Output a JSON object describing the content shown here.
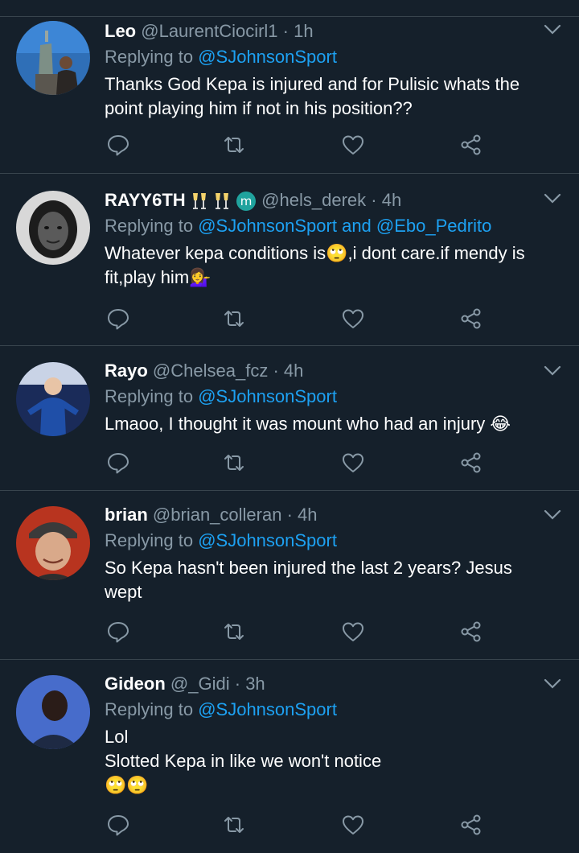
{
  "tweets": [
    {
      "name": "Leo",
      "handle": "@LaurentCiocirl1",
      "dot": "·",
      "time": "1h",
      "replying_prefix": "Replying to",
      "replying_to": "@SJohnsonSport",
      "text_lines": [
        "Thanks God Kepa is injured and for Pulisic whats the",
        "point playing him if not in his position??"
      ],
      "avatar_icon": "statue-of-liberty-photo"
    },
    {
      "name": "RAYY6TH",
      "name_emojis": [
        "champagne-emoji",
        "champagne-emoji",
        "scorpio-emoji"
      ],
      "handle": "@hels_derek",
      "dot": "·",
      "time": "4h",
      "replying_prefix": "Replying to",
      "replying_to": "@SJohnsonSport and @Ebo_Pedrito",
      "text_lines": [
        "Whatever kepa conditions is🙄,i dont care.if mendy is",
        "fit,play him💁‍♀️"
      ],
      "avatar_icon": "woman-bw-photo"
    },
    {
      "name": "Rayo",
      "handle": "@Chelsea_fcz",
      "dot": "·",
      "time": "4h",
      "replying_prefix": "Replying to",
      "replying_to": "@SJohnsonSport",
      "text_lines": [
        "Lmaoo, I thought it was mount who had an injury 😂"
      ],
      "avatar_icon": "chelsea-player-photo"
    },
    {
      "name": "brian",
      "handle": "@brian_colleran",
      "dot": "·",
      "time": "4h",
      "replying_prefix": "Replying to",
      "replying_to": "@SJohnsonSport",
      "text_lines": [
        "So Kepa hasn't been injured the last 2 years? Jesus",
        "wept"
      ],
      "avatar_icon": "man-cap-photo"
    },
    {
      "name": "Gideon",
      "handle": "@_Gidi",
      "dot": "·",
      "time": "3h",
      "replying_prefix": "Replying to",
      "replying_to": "@SJohnsonSport",
      "text_lines": [
        "Lol",
        "Slotted Kepa in like we won't notice",
        "🙄🙄"
      ],
      "avatar_icon": "man-blue-photo"
    }
  ],
  "action_icons": [
    "reply-icon",
    "retweet-icon",
    "like-icon",
    "share-icon"
  ],
  "colors": {
    "background": "#15202b",
    "separator": "#38444d",
    "secondary_text": "#8899a6",
    "link": "#1da1f2",
    "primary_text": "#ffffff"
  }
}
